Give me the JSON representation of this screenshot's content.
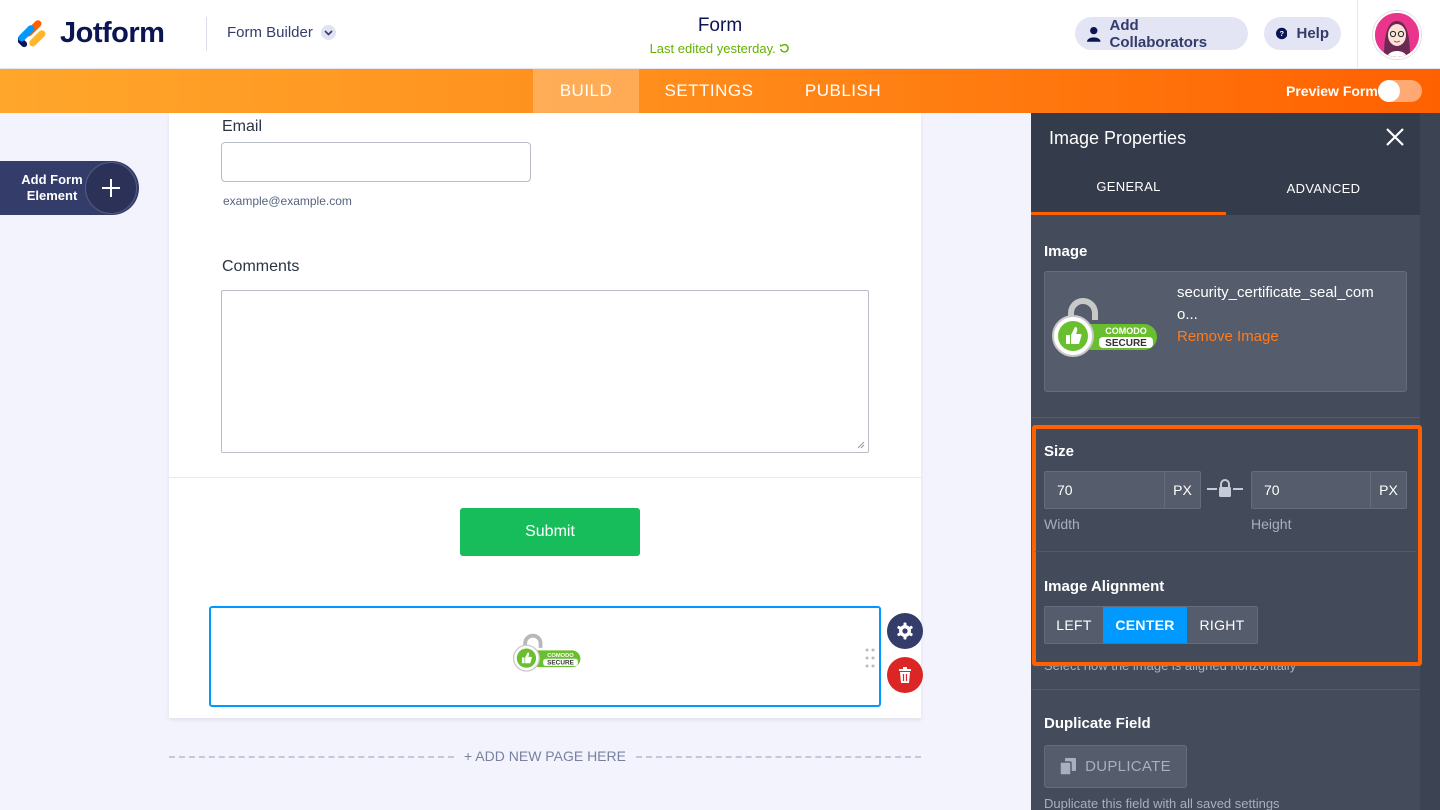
{
  "header": {
    "brand": "Jotform",
    "builder_switch": "Form Builder",
    "form_title": "Form",
    "last_edited": "Last edited yesterday.",
    "add_collaborators": "Add Collaborators",
    "help": "Help"
  },
  "nav": {
    "tabs": [
      "BUILD",
      "SETTINGS",
      "PUBLISH"
    ],
    "active_tab": "BUILD",
    "preview_label": "Preview Form",
    "preview_enabled": false,
    "accent_start": "#ffa62b",
    "accent_end": "#ff6100"
  },
  "left": {
    "add_element_label": "Add Form Element"
  },
  "form": {
    "email_label": "Email",
    "email_value": "",
    "email_sublabel": "example@example.com",
    "comments_label": "Comments",
    "comments_value": "",
    "submit_label": "Submit",
    "image_field_seal": "COMODO SECURE",
    "add_page": "+ ADD NEW PAGE HERE"
  },
  "panel": {
    "title": "Image Properties",
    "tabs": [
      "GENERAL",
      "ADVANCED"
    ],
    "active_tab": "GENERAL",
    "image": {
      "section_label": "Image",
      "filename": "security_certificate_seal_como...",
      "remove_label": "Remove Image",
      "seal_brand": "COMODO",
      "seal_word": "SECURE"
    },
    "size": {
      "section_label": "Size",
      "width": "70",
      "height": "70",
      "unit": "PX",
      "width_label": "Width",
      "height_label": "Height"
    },
    "alignment": {
      "section_label": "Image Alignment",
      "options": [
        "LEFT",
        "CENTER",
        "RIGHT"
      ],
      "selected": "CENTER",
      "hint": "Select how the image is aligned horizontally"
    },
    "duplicate": {
      "section_label": "Duplicate Field",
      "button": "DUPLICATE",
      "hint": "Duplicate this field with all saved settings"
    }
  },
  "icons": {
    "collab": "user-icon",
    "help": "question-icon",
    "close": "close-icon",
    "lock": "lock-icon",
    "gear": "gear-icon",
    "trash": "trash-icon",
    "duplicate": "copy-icon"
  },
  "colors": {
    "highlight": "#ff6100",
    "selected_align": "#0099ff",
    "submit": "#18bd5b",
    "remove_link": "#ff7b1c"
  }
}
